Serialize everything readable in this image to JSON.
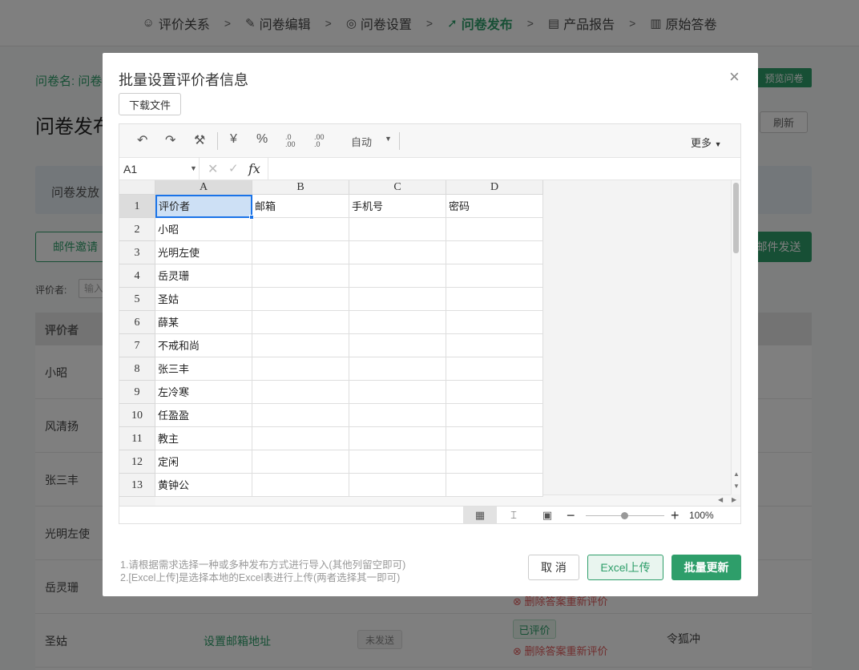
{
  "nav": {
    "steps": [
      {
        "label": "评价关系",
        "icon": "users-icon"
      },
      {
        "label": "问卷编辑",
        "icon": "edit-icon"
      },
      {
        "label": "问卷设置",
        "icon": "settings-icon"
      },
      {
        "label": "问卷发布",
        "icon": "send-icon"
      },
      {
        "label": "产品报告",
        "icon": "report-icon"
      },
      {
        "label": "原始答卷",
        "icon": "chart-icon"
      }
    ],
    "separator": ">"
  },
  "background": {
    "name_label": "问卷名: 问卷",
    "title": "问卷发布",
    "preview_button": "预览问卷",
    "refresh_button": "刷新",
    "notice": "问卷发放",
    "mail_invite_button": "邮件邀请",
    "mail_send_button": "邮件发送",
    "evaluator_label": "评价者:",
    "evaluator_placeholder": "输入",
    "table_header": "评价者",
    "rows": [
      "小昭",
      "风清扬",
      "张三丰",
      "光明左使",
      "岳灵珊",
      "圣姑"
    ],
    "set_email_link": "设置邮箱地址",
    "unsent_badge": "未发送",
    "evaluated_badge": "已评价",
    "delete_answer_link": "删除答案重新评价",
    "evaluatee": "令狐冲"
  },
  "modal": {
    "title": "批量设置评价者信息",
    "download_button": "下载文件",
    "toolbar": {
      "currency": "¥",
      "percent": "%",
      "decimal_increase": ".0 .00",
      "decimal_decrease": ".00 .0",
      "format": "自动",
      "more": "更多"
    },
    "formula": {
      "cell_ref": "A1",
      "fx": "fx"
    },
    "columns": [
      "A",
      "B",
      "C",
      "D"
    ],
    "rows": [
      {
        "num": "1",
        "cells": [
          "评价者",
          "邮箱",
          "手机号",
          "密码"
        ]
      },
      {
        "num": "2",
        "cells": [
          "小昭",
          "",
          "",
          ""
        ]
      },
      {
        "num": "3",
        "cells": [
          "光明左使",
          "",
          "",
          ""
        ]
      },
      {
        "num": "4",
        "cells": [
          "岳灵珊",
          "",
          "",
          ""
        ]
      },
      {
        "num": "5",
        "cells": [
          "圣姑",
          "",
          "",
          ""
        ]
      },
      {
        "num": "6",
        "cells": [
          "薛某",
          "",
          "",
          ""
        ]
      },
      {
        "num": "7",
        "cells": [
          "不戒和尚",
          "",
          "",
          ""
        ]
      },
      {
        "num": "8",
        "cells": [
          "张三丰",
          "",
          "",
          ""
        ]
      },
      {
        "num": "9",
        "cells": [
          "左冷寒",
          "",
          "",
          ""
        ]
      },
      {
        "num": "10",
        "cells": [
          "任盈盈",
          "",
          "",
          ""
        ]
      },
      {
        "num": "11",
        "cells": [
          "教主",
          "",
          "",
          ""
        ]
      },
      {
        "num": "12",
        "cells": [
          "定闲",
          "",
          "",
          ""
        ]
      },
      {
        "num": "13",
        "cells": [
          "黄钟公",
          "",
          "",
          ""
        ]
      }
    ],
    "zoom": "100%",
    "hints": [
      "1.请根据需求选择一种或多种发布方式进行导入(其他列留空即可)",
      "2.[Excel上传]是选择本地的Excel表进行上传(两者选择其一即可)"
    ],
    "cancel_button": "取 消",
    "excel_upload_button": "Excel上传",
    "batch_update_button": "批量更新"
  },
  "colors": {
    "accent": "#2e9e6a",
    "selection": "#1a73e8",
    "danger": "#e05a5a"
  }
}
